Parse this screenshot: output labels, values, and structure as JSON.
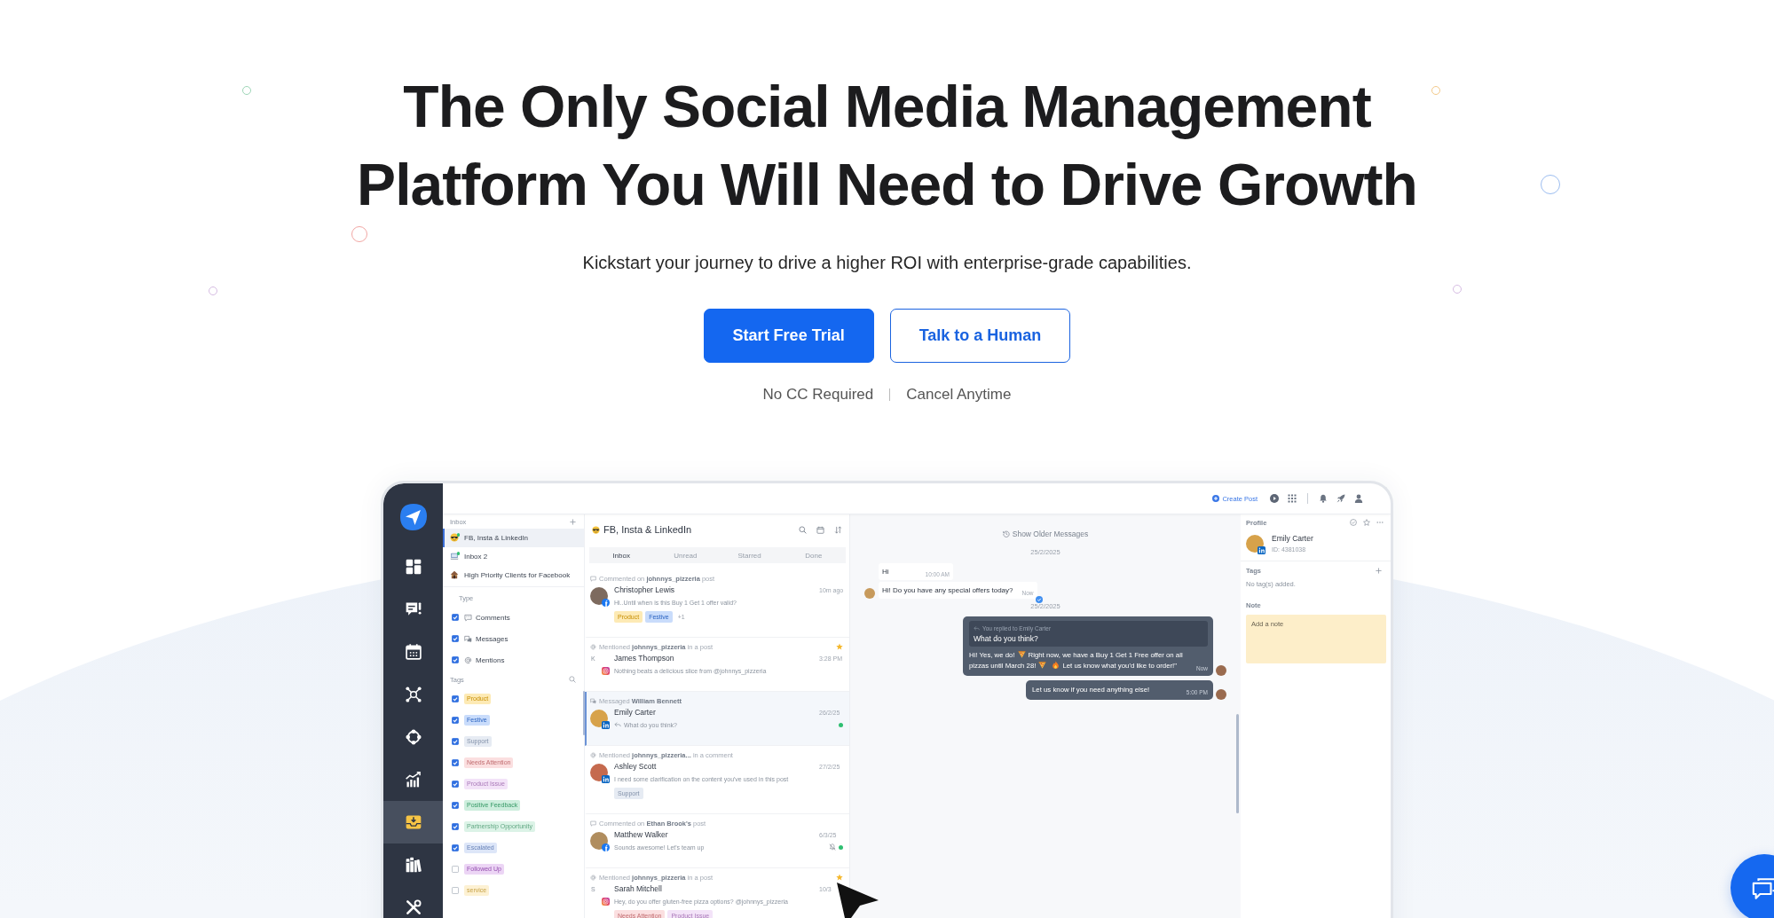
{
  "hero": {
    "heading": "The Only Social Media Management Platform You Will Need to Drive Growth",
    "subheading": "Kickstart your journey to drive a higher ROI with enterprise-grade capabilities.",
    "buttons": [
      {
        "label": "Start Free Trial",
        "kind": "primary"
      },
      {
        "label": "Talk to a Human",
        "kind": "secondary"
      }
    ],
    "notes": [
      "No CC Required",
      "Cancel Anytime"
    ]
  },
  "app": {
    "sidebar": {
      "items": [
        {
          "kind": "dashboard",
          "selected": false
        },
        {
          "kind": "messages",
          "selected": false
        },
        {
          "kind": "calendar",
          "selected": false
        },
        {
          "kind": "network",
          "selected": false
        },
        {
          "kind": "cycle",
          "selected": false
        },
        {
          "kind": "analytics",
          "selected": false
        },
        {
          "kind": "inbox",
          "selected": true
        },
        {
          "kind": "library",
          "selected": false
        },
        {
          "kind": "tools",
          "selected": false
        }
      ]
    },
    "topbar": {
      "create_post": "Create Post"
    },
    "inbox_panel": {
      "title": "Inbox",
      "inboxes": [
        {
          "label": "FB, Insta & LinkedIn",
          "kind": "sunglasses",
          "unread": true,
          "selected": true
        },
        {
          "label": "Inbox 2",
          "kind": "laptop",
          "unread": true,
          "selected": false
        },
        {
          "label": "High Priority Clients for Facebook",
          "kind": "house",
          "unread": false,
          "selected": false
        }
      ],
      "type_title": "Type",
      "types": [
        {
          "label": "Comments",
          "kind": "comment",
          "checked": true
        },
        {
          "label": "Messages",
          "kind": "message",
          "checked": true
        },
        {
          "label": "Mentions",
          "kind": "mention",
          "checked": true
        }
      ],
      "tags_title": "Tags",
      "tags": [
        {
          "label": "Product",
          "color": "#fdeab5",
          "checked": true
        },
        {
          "label": "Festive",
          "color": "#c9dcfb",
          "checked": true
        },
        {
          "label": "Support",
          "color": "#e6ebf3",
          "checked": true
        },
        {
          "label": "Needs Attention",
          "color": "#fbdfe0",
          "checked": true
        },
        {
          "label": "Product Issue",
          "color": "#f3e3f8",
          "checked": true
        },
        {
          "label": "Positive Feedback",
          "color": "#cdeedd",
          "checked": true
        },
        {
          "label": "Partnership Opportunity",
          "color": "#dcf3e7",
          "checked": true
        },
        {
          "label": "Escalated",
          "color": "#dde6f8",
          "checked": true
        },
        {
          "label": "Followed Up",
          "color": "#ecd5f5",
          "checked": false
        },
        {
          "label": "service",
          "color": "#fdf1d3",
          "checked": false
        }
      ]
    },
    "conversations": {
      "kind": "sunglasses",
      "title": "FB, Insta & LinkedIn",
      "tabs": [
        {
          "label": "Inbox",
          "selected": true
        },
        {
          "label": "Unread",
          "selected": false
        },
        {
          "label": "Starred",
          "selected": false
        },
        {
          "label": "Done",
          "selected": false
        }
      ],
      "items": [
        {
          "activity": {
            "kind": "comment",
            "text": "Commented on **johnnys_pizzeria** post"
          },
          "name": "Christopher Lewis",
          "time": "10m ago",
          "badge": {
            "kind": "facebook"
          },
          "replied": false,
          "preview": "Hi..Until when is this Buy 1 Get 1 offer valid?",
          "tags": [
            {
              "label": "Product",
              "color": "#fdeab5"
            },
            {
              "label": "Festive",
              "color": "#c9dcfb"
            }
          ],
          "more_tags": "+1",
          "starred": false,
          "unread": false,
          "muted": false,
          "selected": false
        },
        {
          "activity": {
            "kind": "mention",
            "text": "Mentioned **johnnys_pizzeria** in a post"
          },
          "name": "James Thompson",
          "time": "3:28 PM",
          "avatar_letter": "K",
          "badge": {
            "kind": "instagram"
          },
          "replied": false,
          "preview": "Nothing beats a delicious slice from @johnnys_pizzeria",
          "starred": true,
          "unread": false,
          "muted": false,
          "selected": false
        },
        {
          "activity": {
            "kind": "message",
            "text": "Messaged **William Bennett**"
          },
          "name": "Emily Carter",
          "time": "26/2/25",
          "badge": {
            "kind": "linkedin"
          },
          "replied": true,
          "preview": "What do you think?",
          "starred": false,
          "unread": true,
          "muted": false,
          "selected": true
        },
        {
          "activity": {
            "kind": "mention",
            "text": "Mentioned **johnnys_pizzeria...** in a comment"
          },
          "name": "Ashley Scott",
          "time": "27/2/25",
          "badge": {
            "kind": "linkedin"
          },
          "replied": false,
          "preview": "I need some clarification on the content you've used in this post",
          "tags": [
            {
              "label": "Support",
              "color": "#e6ebf3"
            }
          ],
          "starred": false,
          "unread": false,
          "muted": false,
          "selected": false
        },
        {
          "activity": {
            "kind": "comment",
            "text": "Commented on **Ethan Brook's** post"
          },
          "name": "Matthew Walker",
          "time": "6/3/25",
          "badge": {
            "kind": "facebook"
          },
          "replied": false,
          "preview": "Sounds awesome! Let's team up",
          "starred": false,
          "unread": true,
          "muted": true,
          "selected": false
        },
        {
          "activity": {
            "kind": "mention",
            "text": "Mentioned **johnnys_pizzeria** in a post"
          },
          "name": "Sarah Mitchell",
          "time": "10/3",
          "avatar_letter": "S",
          "badge": {
            "kind": "instagram"
          },
          "replied": false,
          "preview": "Hey, do you offer gluten-free pizza options? @johnnys_pizzeria",
          "tags": [
            {
              "label": "Needs Attention",
              "color": "#fbdfe0"
            },
            {
              "label": "Product Issue",
              "color": "#f3e3f8"
            }
          ],
          "starred": true,
          "unread": false,
          "muted": false,
          "selected": false
        }
      ]
    },
    "chat": {
      "older": "Show Older Messages",
      "entries": [
        {
          "kind": "date",
          "text": "25/2/2025"
        },
        {
          "kind": "incoming",
          "messages": [
            {
              "text": "Hi",
              "time": "10:00 AM",
              "seen": false
            },
            {
              "text": "Hi! Do you have any special offers today?",
              "time": "Now",
              "seen": true
            }
          ]
        },
        {
          "kind": "date",
          "text": "25/2/2025"
        },
        {
          "kind": "outgoing",
          "reply_to": "You replied to Emily Carter",
          "quoted": "What do you think?",
          "parts": [
            {
              "kind": "text",
              "text": "Hi! Yes, we do!"
            },
            {
              "kind": "pizza"
            },
            {
              "kind": "text",
              "text": "Right now, we have a Buy 1 Get 1 Free offer on all pizzas until March 28!"
            },
            {
              "kind": "pizza"
            },
            {
              "kind": "fire"
            },
            {
              "kind": "text",
              "text": "Let us know what you'd like to order!\""
            }
          ],
          "time": "Now"
        },
        {
          "kind": "outgoing",
          "parts": [
            {
              "kind": "text",
              "text": "Let us know if you need anything else!"
            }
          ],
          "time": "5:00 PM"
        }
      ]
    },
    "profile": {
      "title": "Profile",
      "name": "Emily Carter",
      "id": "ID: 4381038",
      "badge": {
        "kind": "linkedin"
      },
      "tags_title": "Tags",
      "tags_empty": "No tag(s) added.",
      "note": {
        "title": "Note",
        "placeholder": "Add a note"
      }
    }
  }
}
